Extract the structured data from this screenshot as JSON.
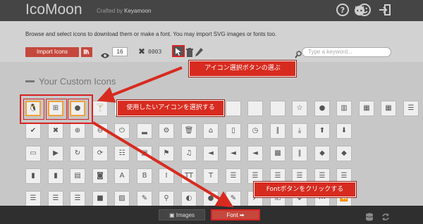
{
  "header": {
    "logo": "IcoMoon",
    "crafted_prefix": "Crafted by",
    "crafted_author": "Keyamoon",
    "icons": [
      "github-icon",
      "help-icon",
      "smile-icon",
      "logout-icon"
    ]
  },
  "toolbar": {
    "description": "Browse and select icons to download them or make a font. You may import SVG images or fonts too.",
    "import_label": "Import Icons",
    "library_label": "lib",
    "size_value": "16",
    "selected_count": "0003",
    "search_placeholder": "Type a keyword..."
  },
  "section": {
    "title": "Your Custom Icons"
  },
  "icon_rows": [
    [
      "linux",
      "windows",
      "apple",
      "cocktail",
      "blank",
      "blank",
      "blank",
      "blank",
      "blank",
      "blank",
      "blank",
      "blank",
      "star",
      "user",
      "film",
      "grid-large",
      "grid",
      "list"
    ],
    [
      "check",
      "close",
      "zoom-in",
      "zoom-out",
      "power",
      "signal",
      "gear",
      "trash",
      "home",
      "file",
      "clock",
      "road",
      "download",
      "arrow-up-circle",
      "arrow-down-circle",
      "",
      "",
      ""
    ],
    [
      "inbox",
      "play-circle",
      "repeat",
      "refresh",
      "list-alt",
      "lock",
      "flag",
      "headphones",
      "volume-off",
      "volume-down",
      "volume-up",
      "qrcode",
      "barcode",
      "tag",
      "tags",
      "",
      "",
      ""
    ],
    [
      "book",
      "bookmark",
      "print",
      "camera",
      "A",
      "B",
      "I",
      "TT",
      "T",
      "indent-left",
      "indent-right",
      "align-left",
      "align-center",
      "align-right",
      "align-justify",
      "",
      "",
      ""
    ],
    [
      "list",
      "indent",
      "indent2",
      "video",
      "image",
      "pencil",
      "marker",
      "contrast",
      "tint",
      "edit",
      "share",
      "check-square",
      "move",
      "step-back",
      "fast-back",
      "",
      "",
      ""
    ]
  ],
  "annotations": {
    "select_mode": "アイコン選択ボタンの選ぶ",
    "select_icons": "使用したいアイコンを選択する",
    "click_font": "Fontボタンをクリックする"
  },
  "footer": {
    "images_label": "Images",
    "font_label": "Font ➡"
  },
  "colors": {
    "accent_red": "#c5483d",
    "annotation_red": "#d72b1f",
    "selection_orange": "#f0a23b"
  }
}
